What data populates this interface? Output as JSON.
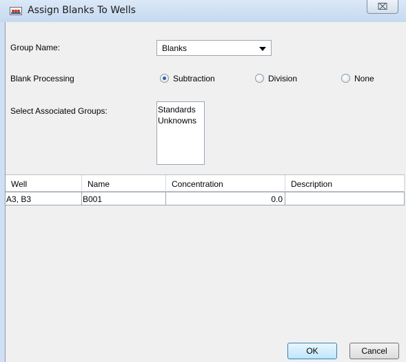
{
  "window": {
    "title": "Assign Blanks To Wells",
    "close_glyph": "⌧"
  },
  "form": {
    "group_name_label": "Group Name:",
    "group_name_value": "Blanks",
    "blank_processing_label": "Blank Processing",
    "blank_processing_options": [
      {
        "label": "Subtraction",
        "selected": true
      },
      {
        "label": "Division",
        "selected": false
      },
      {
        "label": "None",
        "selected": false
      }
    ],
    "associated_groups_label": "Select Associated Groups:",
    "associated_groups": [
      "Standards",
      "Unknowns"
    ]
  },
  "table": {
    "columns": [
      "Well",
      "Name",
      "Concentration",
      "Description"
    ],
    "rows": [
      {
        "well": "A3, B3",
        "name": "B001",
        "concentration": "0.0",
        "description": ""
      }
    ]
  },
  "buttons": {
    "ok": "OK",
    "cancel": "Cancel"
  },
  "colors": {
    "title_bar": "#c5d9f0",
    "client_bg": "#f0f0f0",
    "radio_selected": "#2a5fa8",
    "ok_border": "#3c7fb1"
  },
  "icons": {
    "app": "app-icon",
    "close": "close-icon",
    "dropdown": "chevron-down-icon"
  }
}
